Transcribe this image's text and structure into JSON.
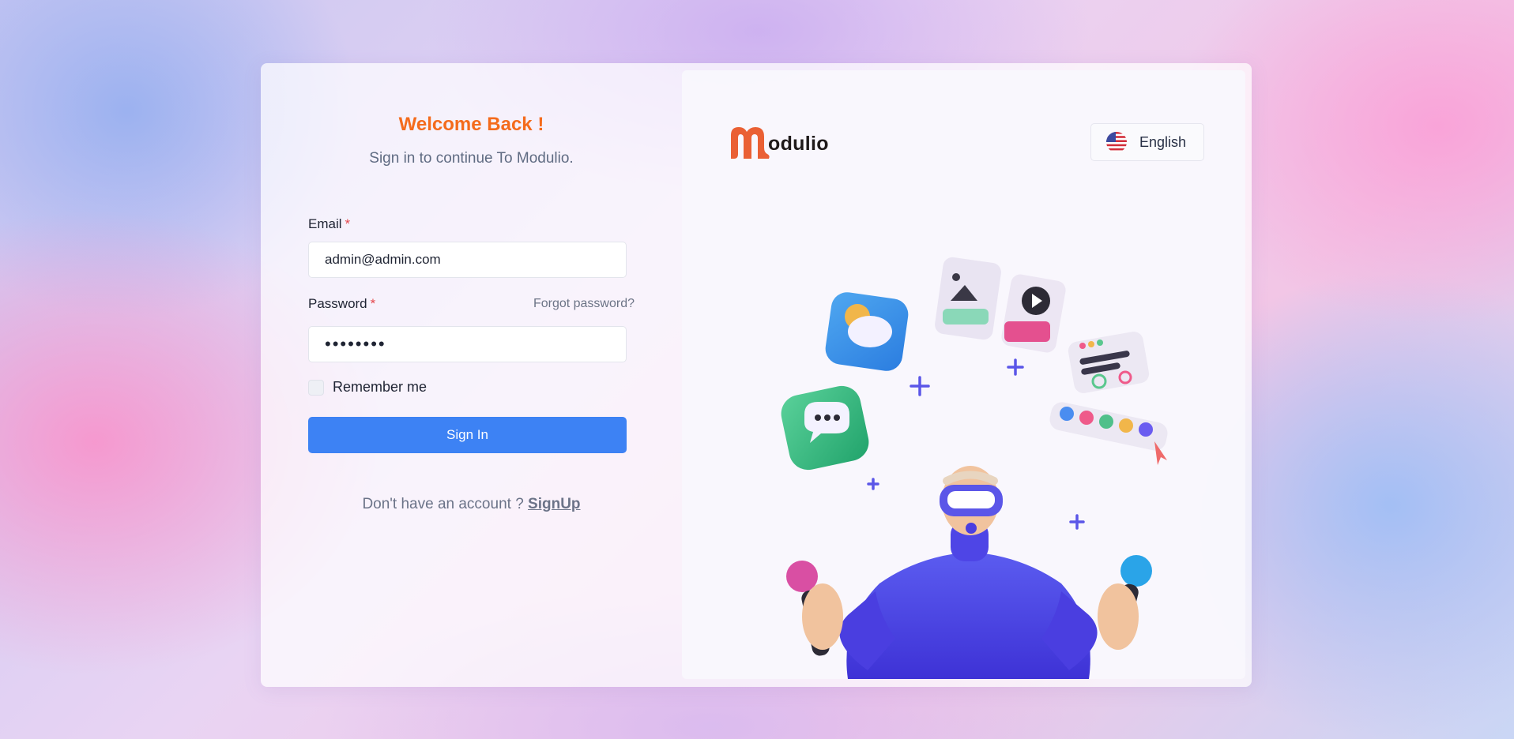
{
  "login": {
    "title": "Welcome Back !",
    "subtitle": "Sign in to continue To Modulio.",
    "email_label": "Email",
    "email_value": "admin@admin.com",
    "password_label": "Password",
    "required_marker": "*",
    "password_value": "••••••••",
    "forgot_label": "Forgot password?",
    "remember_label": "Remember me",
    "remember_checked": false,
    "signin_label": "Sign In",
    "no_account_text": "Don't have an account ?",
    "signup_label": "SignUp"
  },
  "brand": {
    "name": "odulio",
    "logo_letter": "M",
    "logo_color": "#ea6034"
  },
  "language": {
    "label": "English",
    "flag": "us-flag-icon"
  },
  "colors": {
    "accent_orange": "#f46b1c",
    "button_blue": "#3d82f4"
  }
}
